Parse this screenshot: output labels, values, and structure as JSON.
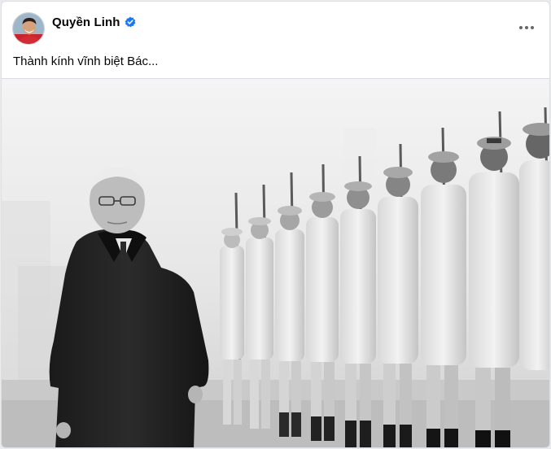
{
  "post": {
    "author": {
      "name": "Quyền Linh",
      "verified": true,
      "avatar_icon": "profile-avatar",
      "verified_icon": "verified-badge-icon",
      "verified_color": "#1877f2"
    },
    "more_icon": "more-options-icon",
    "caption": "Thành kính vĩnh biệt Bác...",
    "image": {
      "kind": "black-and-white photograph",
      "icon": "post-photo"
    }
  },
  "colors": {
    "text_primary": "#050505",
    "background": "#ffffff",
    "border": "#dadde1",
    "more_icon": "#65676b"
  }
}
